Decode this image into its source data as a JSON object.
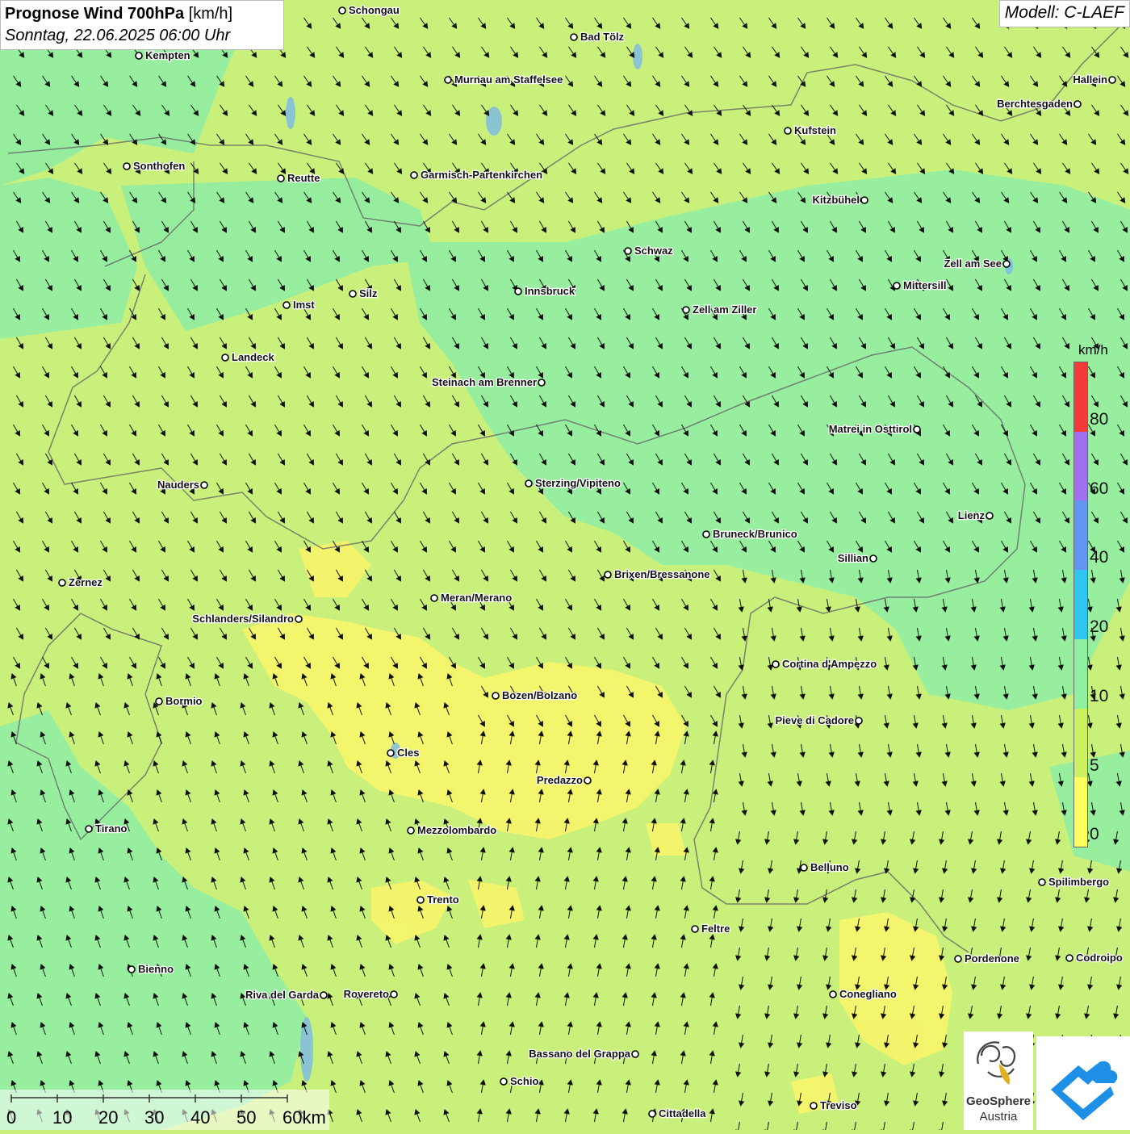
{
  "title": {
    "main_bold": "Prognose Wind 700hPa",
    "unit": "[km/h]",
    "datetime": "Sonntag, 22.06.2025 06:00 Uhr"
  },
  "model_label": "Modell: C-LAEF",
  "legend": {
    "unit": "km/h",
    "ticks": [
      "80",
      "60",
      "40",
      "20",
      "10",
      "5",
      "0"
    ],
    "colors": [
      "#f53a3a",
      "#a070f0",
      "#6496f0",
      "#2ec6f0",
      "#8ef0a0",
      "#ccf060",
      "#ffff60"
    ]
  },
  "scale": {
    "labels": [
      "0",
      "10",
      "20",
      "30",
      "40",
      "50",
      "60km"
    ]
  },
  "logos": {
    "geosphere_line1": "GeoSphere",
    "geosphere_line2": "Austria"
  },
  "colors": {
    "field_yellow": "#f6f46c",
    "field_lightgreen": "#c9f07a",
    "field_green": "#95eda0"
  },
  "places": [
    {
      "name": "Schongau",
      "label": "Schongau",
      "side": "right"
    },
    {
      "name": "Bad Tölz",
      "label": "Bad Tölz",
      "side": "right"
    },
    {
      "name": "Kempten",
      "label": "Kempten",
      "side": "right"
    },
    {
      "name": "Hallein",
      "label": "Hallein",
      "side": "left"
    },
    {
      "name": "Murnau am Staffelsee",
      "label": "Murnau am Staffelsee",
      "side": "right"
    },
    {
      "name": "Berchtesgaden",
      "label": "Berchtesgaden",
      "side": "left"
    },
    {
      "name": "Kufstein",
      "label": "Kufstein",
      "side": "right"
    },
    {
      "name": "Sonthofen",
      "label": "Sonthofen",
      "side": "right"
    },
    {
      "name": "Reutte",
      "label": "Reutte",
      "side": "right"
    },
    {
      "name": "Garmisch-Partenkirchen",
      "label": "Garmisch-Partenkirchen",
      "side": "right"
    },
    {
      "name": "Kitzbühel",
      "label": "Kitzbühel",
      "side": "left"
    },
    {
      "name": "Schwaz",
      "label": "Schwaz",
      "side": "right"
    },
    {
      "name": "Zell am See",
      "label": "Zell am See",
      "side": "left"
    },
    {
      "name": "Mittersill",
      "label": "Mittersill",
      "side": "right"
    },
    {
      "name": "Innsbruck",
      "label": "Innsbruck",
      "side": "right"
    },
    {
      "name": "Silz",
      "label": "Silz",
      "side": "right"
    },
    {
      "name": "Imst",
      "label": "Imst",
      "side": "right"
    },
    {
      "name": "Zell am Ziller",
      "label": "Zell am Ziller",
      "side": "right"
    },
    {
      "name": "Landeck",
      "label": "Landeck",
      "side": "right"
    },
    {
      "name": "Steinach am Brenner",
      "label": "Steinach am Brenner",
      "side": "left"
    },
    {
      "name": "Matrei in Osttirol",
      "label": "Matrei in Osttirol",
      "side": "left"
    },
    {
      "name": "Nauders",
      "label": "Nauders",
      "side": "left"
    },
    {
      "name": "Sterzing/Vipiteno",
      "label": "Sterzing/Vipiteno",
      "side": "right"
    },
    {
      "name": "Lienz",
      "label": "Lienz",
      "side": "left"
    },
    {
      "name": "Bruneck/Brunico",
      "label": "Bruneck/Brunico",
      "side": "right"
    },
    {
      "name": "Sillian",
      "label": "Sillian",
      "side": "left"
    },
    {
      "name": "Brixen/Bressanone",
      "label": "Brixen/Bressanone",
      "side": "right"
    },
    {
      "name": "Zernez",
      "label": "Zernez",
      "side": "right"
    },
    {
      "name": "Meran/Merano",
      "label": "Meran/Merano",
      "side": "right"
    },
    {
      "name": "Schlanders/Silandro",
      "label": "Schlanders/Silandro",
      "side": "left"
    },
    {
      "name": "Cortina d'Ampezzo",
      "label": "Cortina d'Ampezzo",
      "side": "right"
    },
    {
      "name": "Bozen/Bolzano",
      "label": "Bozen/Bolzano",
      "side": "right"
    },
    {
      "name": "Bormio",
      "label": "Bormio",
      "side": "right"
    },
    {
      "name": "Pieve di Cadore",
      "label": "Pieve di Cadore",
      "side": "left"
    },
    {
      "name": "Cles",
      "label": "Cles",
      "side": "right"
    },
    {
      "name": "Predazzo",
      "label": "Predazzo",
      "side": "left"
    },
    {
      "name": "Tirano",
      "label": "Tirano",
      "side": "right"
    },
    {
      "name": "Mezzolombardo",
      "label": "Mezzolombardo",
      "side": "right"
    },
    {
      "name": "Belluno",
      "label": "Belluno",
      "side": "right"
    },
    {
      "name": "Spilimbergo",
      "label": "Spilimbergo",
      "side": "right"
    },
    {
      "name": "Trento",
      "label": "Trento",
      "side": "right"
    },
    {
      "name": "Feltre",
      "label": "Feltre",
      "side": "right"
    },
    {
      "name": "Pordenone",
      "label": "Pordenone",
      "side": "right"
    },
    {
      "name": "Codroipo",
      "label": "Codroipo",
      "side": "right"
    },
    {
      "name": "Bienno",
      "label": "Bienno",
      "side": "right"
    },
    {
      "name": "Riva del Garda",
      "label": "Riva del Garda",
      "side": "left"
    },
    {
      "name": "Rovereto",
      "label": "Rovereto",
      "side": "left"
    },
    {
      "name": "Conegliano",
      "label": "Conegliano",
      "side": "right"
    },
    {
      "name": "Bassano del Grappa",
      "label": "Bassano del Grappa",
      "side": "left"
    },
    {
      "name": "Schio",
      "label": "Schio",
      "side": "right"
    },
    {
      "name": "Treviso",
      "label": "Treviso",
      "side": "right"
    },
    {
      "name": "Cittadella",
      "label": "Cittadella",
      "side": "right"
    }
  ]
}
